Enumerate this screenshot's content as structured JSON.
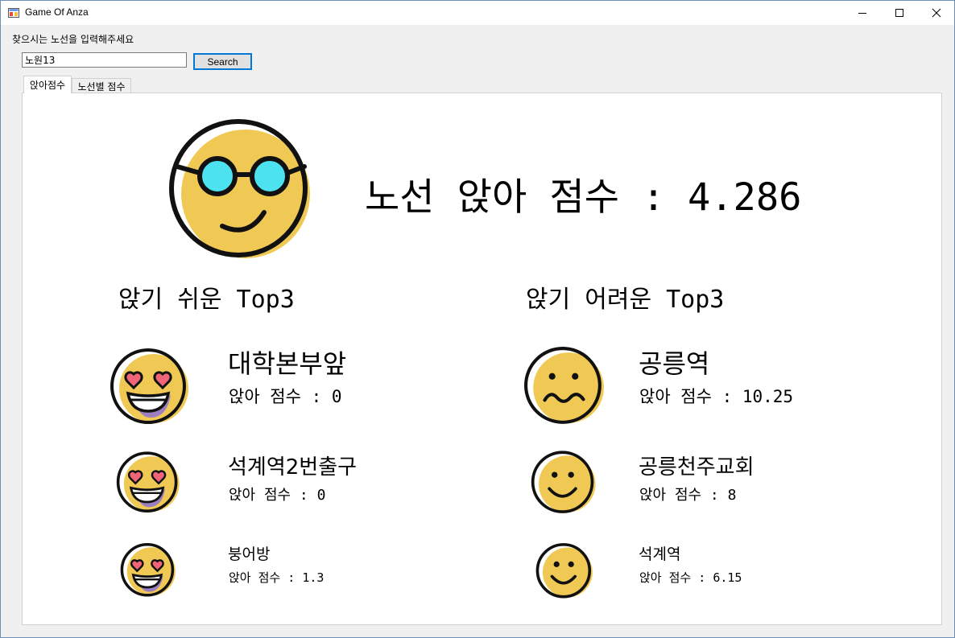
{
  "window": {
    "title": "Game Of Anza",
    "controls": {
      "minimize": "minimize-icon",
      "maximize": "maximize-icon",
      "close": "close-icon"
    }
  },
  "search": {
    "prompt": "찾으시는 노선을 입력해주세요",
    "value": "노원13",
    "button_label": "Search"
  },
  "tabs": [
    {
      "label": "앉아점수",
      "active": true
    },
    {
      "label": "노선별 점수",
      "active": false
    }
  ],
  "main": {
    "score_label": "노선 앉아 점수 :",
    "score_value": "4.286",
    "mascot_icon": "glasses-smiley-icon"
  },
  "easy": {
    "title": "앉기 쉬운 Top3",
    "items": [
      {
        "name": "대학본부앞",
        "score_label": "앉아 점수 : 0",
        "icon": "heart-eyes-icon"
      },
      {
        "name": "석계역2번출구",
        "score_label": "앉아 점수 : 0",
        "icon": "heart-eyes-icon"
      },
      {
        "name": "붕어방",
        "score_label": "앉아 점수 : 1.3",
        "icon": "heart-eyes-icon"
      }
    ]
  },
  "hard": {
    "title": "앉기 어려운 Top3",
    "items": [
      {
        "name": "공릉역",
        "score_label": "앉아 점수 : 10.25",
        "icon": "queasy-face-icon"
      },
      {
        "name": "공릉천주교회",
        "score_label": "앉아 점수 : 8",
        "icon": "smiley-icon"
      },
      {
        "name": "석계역",
        "score_label": "앉아 점수 : 6.15",
        "icon": "smiley-icon"
      }
    ]
  },
  "colors": {
    "face_yellow": "#f0c955",
    "outline": "#111111",
    "lens_cyan": "#4de2ef",
    "heart_pink": "#f0647a",
    "mouth_purple": "#9b7fc0",
    "accent_blue": "#0078d7"
  }
}
